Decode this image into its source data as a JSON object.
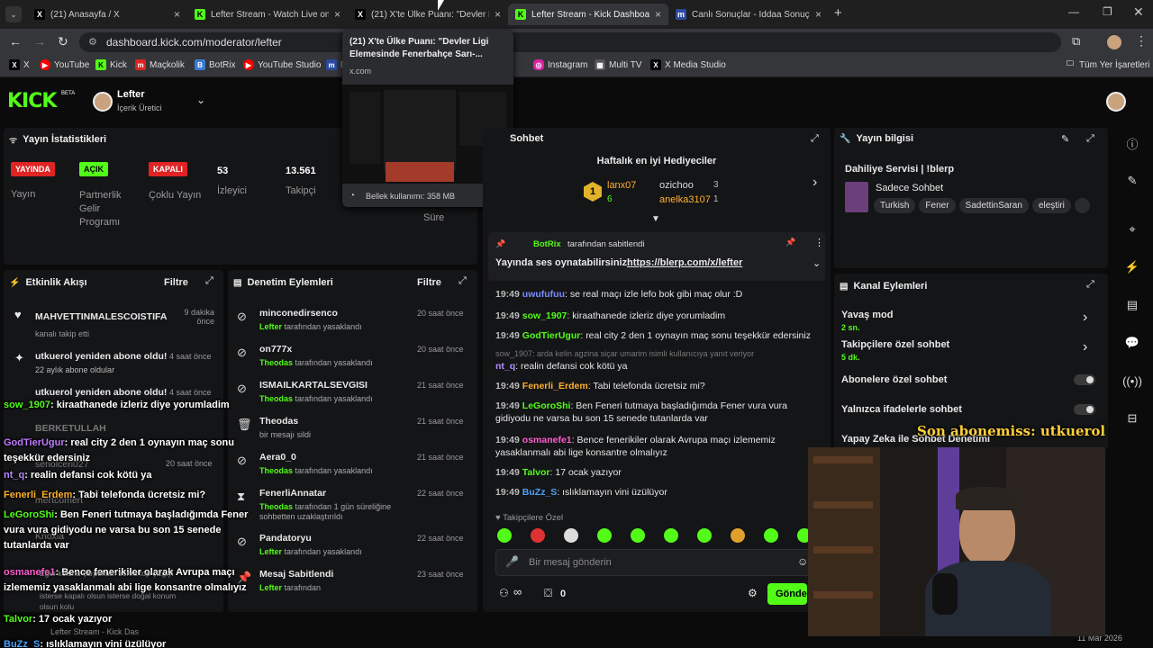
{
  "browser": {
    "tabs": [
      {
        "label": "(21) Anasayfa / X",
        "icon": "X",
        "color": "#000"
      },
      {
        "label": "Lefter Stream - Watch Live on K",
        "icon": "K",
        "color": "#53fc18"
      },
      {
        "label": "(21) X'te Ülke Puanı: \"Devler Lig",
        "icon": "X",
        "color": "#000"
      },
      {
        "label": "Lefter Stream - Kick Dashboard",
        "icon": "K",
        "color": "#53fc18"
      },
      {
        "label": "Canlı Sonuçlar - İddaa Sonuçla",
        "icon": "m",
        "color": "#2b4aa0"
      }
    ],
    "url": "dashboard.kick.com/moderator/lefter",
    "bookmarks": [
      "X",
      "YouTube",
      "Kick",
      "Maçkolik",
      "BotRix",
      "YouTube Studio",
      "M",
      "Instagram",
      "Multi TV",
      "X Media Studio"
    ],
    "bookmarks_all": "Tüm Yer İşaretleri",
    "tooltip": {
      "title": "(21) X'te Ülke Puanı: \"Devler Ligi Elemesinde Fenerbahçe Sarı-...",
      "domain": "x.com",
      "memory": "Bellek kullanımı: 358 MB"
    }
  },
  "header": {
    "logo": "KICK",
    "beta": "BETA",
    "user": "Lefter",
    "role": "İçerik Üretici"
  },
  "stats": {
    "title": "Yayın İstatistikleri",
    "items": [
      {
        "badge": "YAYINDA",
        "label": "Yayın",
        "color": "#e02424",
        "fg": "#fff"
      },
      {
        "badge": "AÇIK",
        "label": "Partnerlik Gelir Programı",
        "color": "#53fc18",
        "fg": "#000"
      },
      {
        "badge": "KAPALI",
        "label": "Çoklu Yayın",
        "color": "#e02424",
        "fg": "#fff"
      },
      {
        "badge": "53",
        "label": "İzleyici"
      },
      {
        "badge": "13.561",
        "label": "Takipçi"
      }
    ],
    "extra": "Süre"
  },
  "activity": {
    "title": "Etkinlik Akışı",
    "filter": "Filtre",
    "items": [
      {
        "name": "MAHVETTINMALESCOISTIFA",
        "desc": "kanalı takip etti",
        "time": "9 dakika önce"
      },
      {
        "name": "utkuerol yeniden abone oldu!",
        "desc": "22 aylık abone oldular",
        "time": "4 saat önce"
      },
      {
        "name": "utkuerol yeniden abone oldu!",
        "desc": "",
        "time": "4 saat önce"
      },
      {
        "name": "BERKETULLAH",
        "desc": "",
        "time": ""
      },
      {
        "name": "senolceri027",
        "desc": "",
        "time": "20 saat önce"
      },
      {
        "name": "mertcomert",
        "desc": "",
        "time": ""
      },
      {
        "name": "Knoxia",
        "desc": "",
        "time": ""
      }
    ]
  },
  "moderation": {
    "title": "Denetim Eylemleri",
    "filter": "Filtre",
    "items": [
      {
        "name": "minconedirsenco",
        "by": "Lefter",
        "desc": "tarafından yasaklandı",
        "time": "20 saat önce"
      },
      {
        "name": "on777x",
        "by": "Theodas",
        "desc": "tarafından yasaklandı",
        "time": "20 saat önce"
      },
      {
        "name": "ISMAILKARTALSEVGISI",
        "by": "Theodas",
        "desc": "tarafından yasaklandı",
        "time": "21 saat önce"
      },
      {
        "name": "Theodas",
        "by": "",
        "desc": "bir mesajı sildi",
        "time": "21 saat önce"
      },
      {
        "name": "Aera0_0",
        "by": "Theodas",
        "desc": "tarafından yasaklandı",
        "time": "21 saat önce"
      },
      {
        "name": "FenerliAnnatar",
        "by": "Theodas",
        "desc": "tarafından 1 gün süreliğine sohbetten uzaklaştırıldı",
        "time": "22 saat önce"
      },
      {
        "name": "Pandatoryu",
        "by": "Lefter",
        "desc": "tarafından yasaklandı",
        "time": "22 saat önce"
      },
      {
        "name": "Mesaj Sabitlendi",
        "by": "Lefter",
        "desc": "tarafından",
        "time": "23 saat önce"
      }
    ]
  },
  "chat": {
    "title": "Sohbet",
    "gifters_title": "Haftalık en iyi Hediyeciler",
    "gifters": [
      {
        "name": "lanx07",
        "n": "6"
      },
      {
        "name": "ozichoo",
        "n": "3"
      },
      {
        "name": "anelka3107",
        "n": "1"
      }
    ],
    "pinned_by": "BotRix",
    "pinned_suffix": "tarafından sabitlendi",
    "pinned_text": "Yayında ses oynatabilirsiniz.",
    "pinned_link": "https://blerp.com/x/lefter",
    "messages": [
      {
        "time": "19:49",
        "user": "uwufufuu",
        "color": "#7b8cff",
        "text": "se real maçı izle lefo bok gibi maç olur :D"
      },
      {
        "time": "19:49",
        "user": "sow_1907",
        "color": "#53fc18",
        "text": "kiraathanede izleriz diye yorumladim"
      },
      {
        "time": "19:49",
        "user": "GodTierUgur",
        "color": "#53fc18",
        "text": "real city 2 den 1 oynayın maç sonu teşekkür edersiniz"
      },
      {
        "time": "",
        "user": "nt_q",
        "color": "#b58cff",
        "text": "realin defansi cok kötü ya",
        "reply": "sow_1907: arda kelin agzina siçar umarim isimli kullanıcıya yanıt veriyor"
      },
      {
        "time": "19:49",
        "user": "Fenerli_Erdem",
        "color": "#ffb02e",
        "text": "Tabi telefonda ücretsiz mi?"
      },
      {
        "time": "19:49",
        "user": "LeGoroShi",
        "color": "#53fc18",
        "text": "Ben Feneri tutmaya başladığımda Fener vura vura gidiyodu ne varsa bu son 15 senede tutanlarda var"
      },
      {
        "time": "19:49",
        "user": "osmanefe1",
        "color": "#ff5bd0",
        "text": "Bence fenerikiler olarak Avrupa maçı izlememiz yasaklanmalı abi lige konsantre olmalıyız"
      },
      {
        "time": "19:49",
        "user": "Talvor",
        "color": "#53fc18",
        "text": "17 ocak yazıyor"
      },
      {
        "time": "19:49",
        "user": "BuZz_S",
        "color": "#4aa3ff",
        "text": "ıslıklamayın vini üzülüyor"
      }
    ],
    "followers_only": "Takipçilere Özel",
    "placeholder": "Bir mesaj gönderin",
    "count": "0",
    "send": "Gönder"
  },
  "stream_info": {
    "title": "Yayın bilgisi",
    "stream_title": "Dahiliye Servisi | !blerp",
    "category": "Sadece Sohbet",
    "tags": [
      "Turkish",
      "Fener",
      "SadettinSaran",
      "eleştiri"
    ]
  },
  "channel_actions": {
    "title": "Kanal Eylemleri",
    "items": [
      {
        "label": "Yavaş mod",
        "sub": "2 sn."
      },
      {
        "label": "Takipçilere özel sohbet",
        "sub": "5 dk."
      },
      {
        "label": "Abonelere özel sohbet",
        "sub": ""
      },
      {
        "label": "Yalnızca ifadelerle sohbet",
        "sub": ""
      },
      {
        "label": "Yapay Zeka ile Sohbet Denetimi",
        "sub": ""
      }
    ]
  },
  "overlay": {
    "sub_text": "Son abonemiss: utkuerol",
    "lines": [
      {
        "user": "sow_1907",
        "color": "#53fc18",
        "text": ": kiraathanede izleriz diye yorumladim"
      },
      {
        "user": "GodTierUgur",
        "color": "#c07bff",
        "text": ": real city 2 den 1 oynayın maç sonu teşekkür edersiniz"
      },
      {
        "user": "nt_q",
        "color": "#b58cff",
        "text": ": realin defansi cok kötü ya"
      },
      {
        "user": "Fenerli_Erdem",
        "color": "#ffb02e",
        "text": ": Tabi telefonda ücretsiz mi?"
      },
      {
        "user": "LeGoroShi",
        "color": "#53fc18",
        "text": ": Ben Feneri tutmaya başladığımda Fener vura vura gidiyodu ne varsa bu son 15 senede tutanlarda var"
      },
      {
        "user": "osmanefe1",
        "color": "#ff5bd0",
        "text": ": Bence fenerikiler olarak Avrupa maçı izlememiz yasaklanmalı abi lige konsantre olmalıyız"
      },
      {
        "user": "Talvor",
        "color": "#53fc18",
        "text": ": 17 ocak yazıyor"
      },
      {
        "user": "BuZz_S",
        "color": "#4aa3ff",
        "text": ": ıslıklamayın vini üzülüyor"
      }
    ],
    "faint": [
      "Eğer koluna çarptıktan sonra top çizgiyi",
      "isterse kapalı olsun isterse doğal konum",
      "olsun kolu"
    ],
    "taskbar": "Lefter Stream - Kick Das",
    "date": "11 Mar 2026"
  },
  "colors": {
    "accent": "#53fc18",
    "bg": "#0b0b0c",
    "panel": "#141517"
  }
}
